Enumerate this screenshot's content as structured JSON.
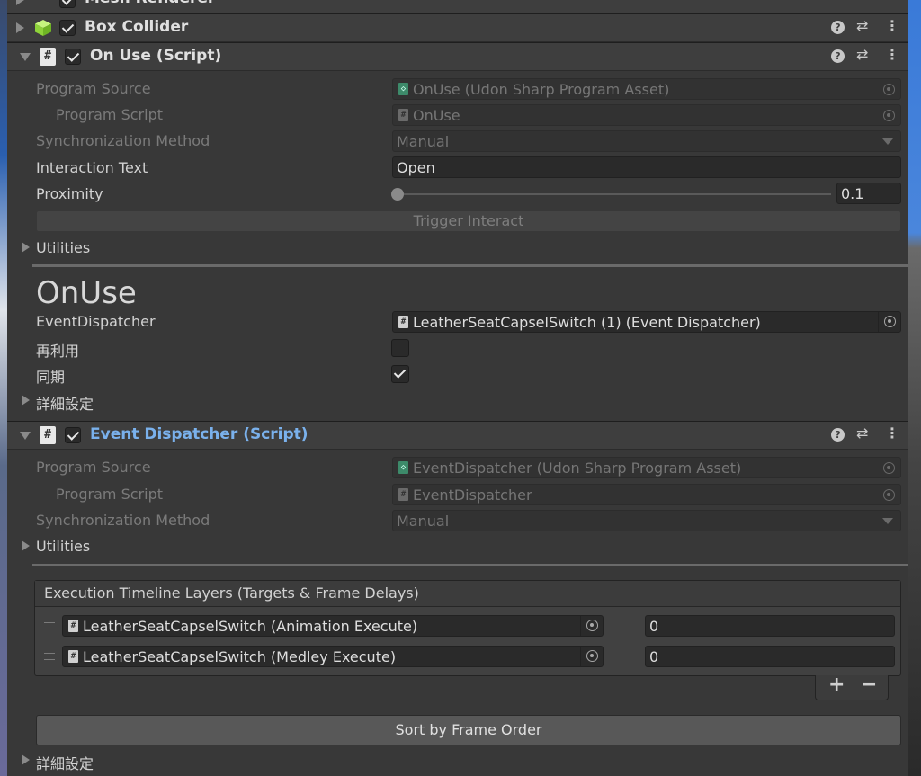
{
  "components": {
    "mesh_renderer": {
      "title": "Mesh Renderer"
    },
    "box_collider": {
      "title": "Box Collider"
    },
    "on_use_script": {
      "title": "On Use (Script)"
    },
    "event_dispatcher_script": {
      "title": "Event Dispatcher (Script)"
    }
  },
  "on_use": {
    "program_source_label": "Program Source",
    "program_source_value": "OnUse (Udon Sharp Program Asset)",
    "program_script_label": "Program Script",
    "program_script_value": "OnUse",
    "sync_method_label": "Synchronization Method",
    "sync_method_value": "Manual",
    "interaction_text_label": "Interaction Text",
    "interaction_text_value": "Open",
    "proximity_label": "Proximity",
    "proximity_value": "0.1",
    "trigger_interact_label": "Trigger Interact",
    "utilities_label": "Utilities",
    "heading": "OnUse",
    "event_dispatcher_label": "EventDispatcher",
    "event_dispatcher_value": "LeatherSeatCapselSwitch (1) (Event Dispatcher)",
    "reuse_label": "再利用",
    "reuse_checked": false,
    "sync_label": "同期",
    "sync_checked": true,
    "advanced_label": "詳細設定"
  },
  "event_dispatcher": {
    "program_source_label": "Program Source",
    "program_source_value": "EventDispatcher (Udon Sharp Program Asset)",
    "program_script_label": "Program Script",
    "program_script_value": "EventDispatcher",
    "sync_method_label": "Synchronization Method",
    "sync_method_value": "Manual",
    "utilities_label": "Utilities",
    "layers_header": "Execution Timeline Layers (Targets & Frame Delays)",
    "layers": [
      {
        "target": "LeatherSeatCapselSwitch (Animation Execute)",
        "delay": "0"
      },
      {
        "target": "LeatherSeatCapselSwitch (Medley Execute)",
        "delay": "0"
      }
    ],
    "add_label": "+",
    "remove_label": "−",
    "sort_button_label": "Sort by Frame Order",
    "advanced_label": "詳細設定"
  },
  "colors": {
    "panel_bg": "#383838",
    "header_bg": "#3e3e3e",
    "highlight_title": "#7ab1ec",
    "cube_green": "#9ee04a"
  }
}
